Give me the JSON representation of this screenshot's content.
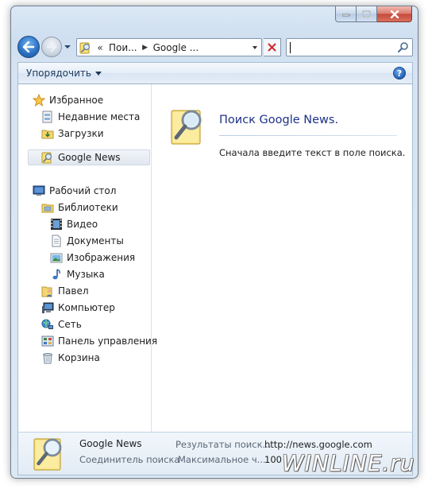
{
  "window": {
    "caption": {
      "minimize": "minimize",
      "maximize": "maximize",
      "close": "close"
    }
  },
  "nav": {
    "address": {
      "overflow": "«",
      "crumbs": [
        "Пои...",
        "Google ..."
      ]
    },
    "search": {
      "value": "",
      "placeholder": ""
    }
  },
  "commandbar": {
    "organize_label": "Упорядочить"
  },
  "sidebar": {
    "favorites": {
      "label": "Избранное",
      "items": [
        {
          "label": "Недавние места",
          "icon": "recent-places-icon"
        },
        {
          "label": "Загрузки",
          "icon": "downloads-folder-icon"
        },
        {
          "label": "Google News",
          "icon": "search-connector-icon",
          "selected": true
        }
      ]
    },
    "desktop": {
      "label": "Рабочий стол",
      "libraries": {
        "label": "Библиотеки",
        "items": [
          {
            "label": "Видео",
            "icon": "video-library-icon"
          },
          {
            "label": "Документы",
            "icon": "documents-library-icon"
          },
          {
            "label": "Изображения",
            "icon": "pictures-library-icon"
          },
          {
            "label": "Музыка",
            "icon": "music-library-icon"
          }
        ]
      },
      "items": [
        {
          "label": "Павел",
          "icon": "user-folder-icon"
        },
        {
          "label": "Компьютер",
          "icon": "computer-icon"
        },
        {
          "label": "Сеть",
          "icon": "network-icon"
        },
        {
          "label": "Панель управления",
          "icon": "control-panel-icon"
        },
        {
          "label": "Корзина",
          "icon": "recycle-bin-icon"
        }
      ]
    }
  },
  "content": {
    "title": "Поиск Google News.",
    "message": "Сначала введите текст в поле поиска."
  },
  "details": {
    "name": "Google News",
    "type": "Соединитель поиска",
    "prop1_label": "Результаты поиск...",
    "prop1_value": "http://news.google.com",
    "prop2_label": "Максимальное ч...",
    "prop2_value": "100"
  },
  "watermark": "WINLINE.ru",
  "colors": {
    "accent": "#1e3287",
    "frame": "#dce8f4",
    "close": "#c5493a"
  }
}
